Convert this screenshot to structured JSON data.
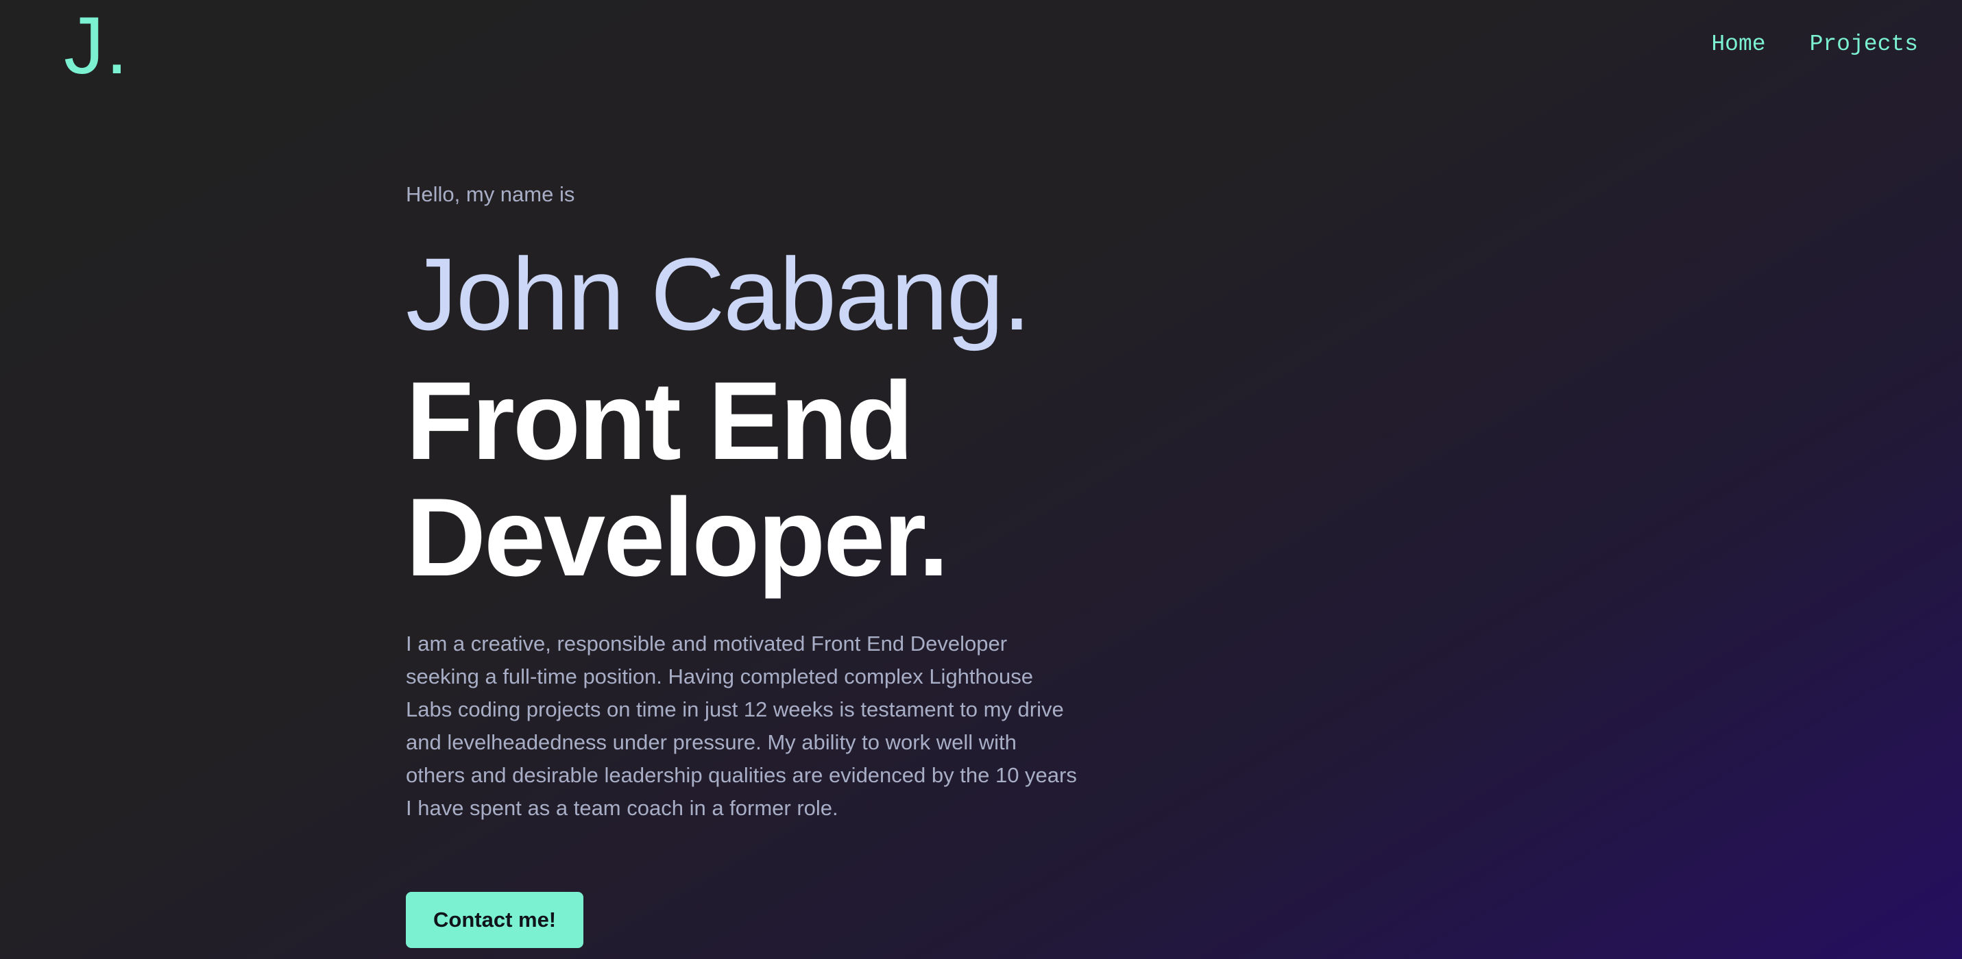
{
  "header": {
    "logo_text": "J.",
    "nav": [
      {
        "label": "Home"
      },
      {
        "label": "Projects"
      }
    ]
  },
  "hero": {
    "greeting": "Hello, my name is",
    "name": "John Cabang.",
    "role": "Front End Developer.",
    "bio": "I am a creative, responsible and motivated Front End Developer seeking a full-time position. Having completed complex Lighthouse Labs coding projects on time in just 12 weeks is testament to my drive and levelheadedness under pressure. My ability to work well with others and desirable leadership qualities are evidenced by the 10 years I have spent as a team coach in a former role.",
    "cta_label": "Contact me!"
  },
  "colors": {
    "accent": "#7bf1d1",
    "background": "#212121",
    "gradient_end": "#250f60",
    "name_text": "#ccd6f6",
    "body_text": "#a9aec7",
    "heading_text": "#ffffff"
  }
}
